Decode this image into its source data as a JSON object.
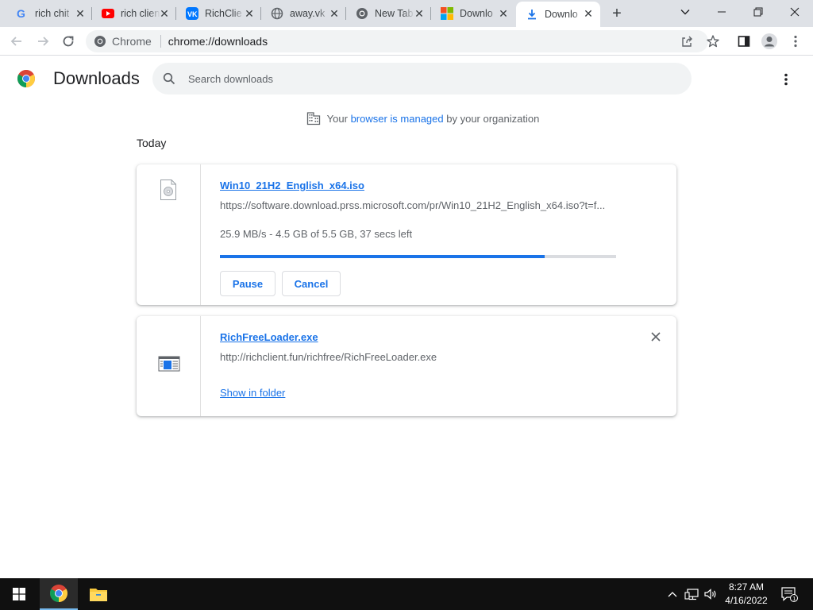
{
  "tabs": [
    {
      "title": "rich chit",
      "icon": "google-icon"
    },
    {
      "title": "rich clien",
      "icon": "youtube-icon"
    },
    {
      "title": "RichClie",
      "icon": "vk-icon"
    },
    {
      "title": "away.vk",
      "icon": "globe-icon"
    },
    {
      "title": "New Tab",
      "icon": "chrome-icon"
    },
    {
      "title": "Downlo",
      "icon": "microsoft-icon"
    },
    {
      "title": "Downlo",
      "icon": "download-icon",
      "active": true
    }
  ],
  "new_tab_label": "+",
  "omnibox": {
    "chip_label": "Chrome",
    "url": "chrome://downloads"
  },
  "page": {
    "title": "Downloads",
    "search_placeholder": "Search downloads",
    "managed": {
      "prefix": "Your",
      "link": "browser is managed",
      "suffix": "by your organization"
    },
    "section_label": "Today"
  },
  "downloads": [
    {
      "file_name": "Win10_21H2_English_x64.iso",
      "url": "https://software.download.prss.microsoft.com/pr/Win10_21H2_English_x64.iso?t=f...",
      "status": "25.9 MB/s - 4.5 GB of 5.5 GB, 37 secs left",
      "progress_fraction": 0.82,
      "pause_label": "Pause",
      "cancel_label": "Cancel"
    },
    {
      "file_name": "RichFreeLoader.exe",
      "url": "http://richclient.fun/richfree/RichFreeLoader.exe",
      "show_in_folder_label": "Show in folder"
    }
  ],
  "taskbar": {
    "time": "8:27 AM",
    "date": "4/16/2022",
    "notification_count": "1"
  },
  "colors": {
    "accent": "#1a73e8",
    "tabstrip": "#dee1e6",
    "taskbar": "#101010"
  }
}
